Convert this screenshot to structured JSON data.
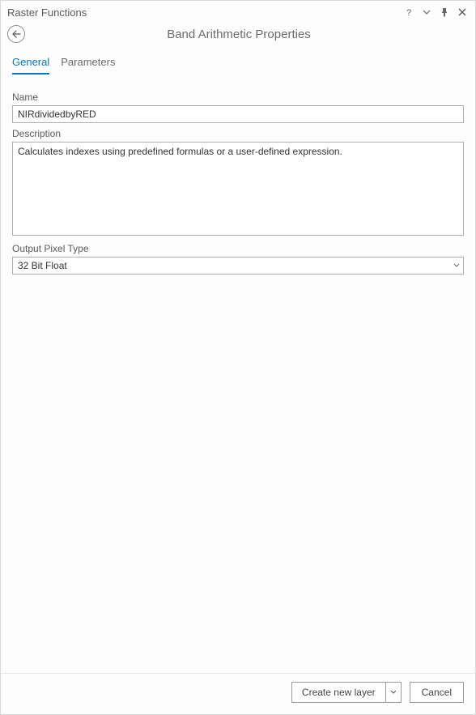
{
  "panel": {
    "title": "Raster Functions",
    "page_title": "Band Arithmetic Properties"
  },
  "tabs": {
    "general": "General",
    "parameters": "Parameters",
    "active": "general"
  },
  "fields": {
    "name_label": "Name",
    "name_value": "NIRdividedbyRED",
    "desc_label": "Description",
    "desc_value": "Calculates indexes using predefined formulas or a user-defined expression.",
    "pixel_label": "Output Pixel Type",
    "pixel_value": "32 Bit Float"
  },
  "footer": {
    "create_label": "Create new layer",
    "cancel_label": "Cancel"
  }
}
